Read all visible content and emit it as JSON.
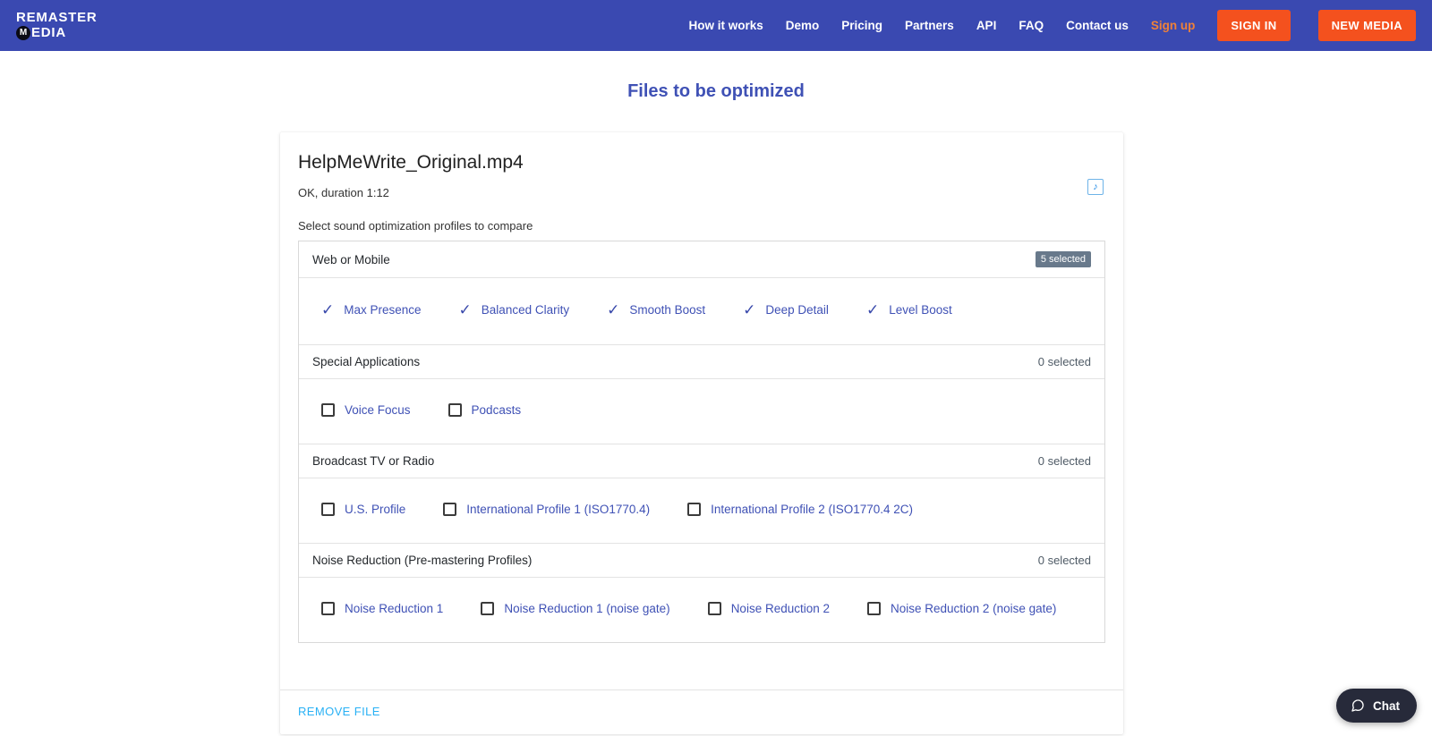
{
  "navbar": {
    "brand": {
      "line1": "REMASTER",
      "logo_letter": "M",
      "line2": "EDIA"
    },
    "links": [
      "How it works",
      "Demo",
      "Pricing",
      "Partners",
      "API",
      "FAQ",
      "Contact us"
    ],
    "signup_label": "Sign up",
    "signin_label": "SIGN IN",
    "new_media_label": "NEW MEDIA"
  },
  "page": {
    "title": "Files to be optimized"
  },
  "file_card": {
    "filename": "HelpMeWrite_Original.mp4",
    "status": "OK, duration 1:12",
    "audio_icon": "music-note-icon",
    "instruction": "Select sound optimization profiles to compare",
    "remove_label": "REMOVE FILE",
    "groups": [
      {
        "name": "Web or Mobile",
        "count": "5 selected",
        "profiles": [
          {
            "label": "Max Presence",
            "checked": true
          },
          {
            "label": "Balanced Clarity",
            "checked": true
          },
          {
            "label": "Smooth Boost",
            "checked": true
          },
          {
            "label": "Deep Detail",
            "checked": true
          },
          {
            "label": "Level Boost",
            "checked": true
          }
        ]
      },
      {
        "name": "Special Applications",
        "count": "0 selected",
        "profiles": [
          {
            "label": "Voice Focus",
            "checked": false
          },
          {
            "label": "Podcasts",
            "checked": false
          }
        ]
      },
      {
        "name": "Broadcast TV or Radio",
        "count": "0 selected",
        "profiles": [
          {
            "label": "U.S. Profile",
            "checked": false
          },
          {
            "label": "International Profile 1 (ISO1770.4)",
            "checked": false
          },
          {
            "label": "International Profile 2 (ISO1770.4 2C)",
            "checked": false
          }
        ]
      },
      {
        "name": "Noise Reduction (Pre-mastering Profiles)",
        "count": "0 selected",
        "profiles": [
          {
            "label": "Noise Reduction 1",
            "checked": false
          },
          {
            "label": "Noise Reduction 1 (noise gate)",
            "checked": false
          },
          {
            "label": "Noise Reduction 2",
            "checked": false
          },
          {
            "label": "Noise Reduction 2 (noise gate)",
            "checked": false
          }
        ]
      }
    ]
  },
  "chat": {
    "label": "Chat"
  },
  "colors": {
    "navbar_bg": "#3a49b1",
    "accent_orange": "#f4511e",
    "signup_orange": "#ef8138",
    "heading_blue": "#3f51b5",
    "profile_blue": "#3f51b5",
    "badge_gray": "#68798b",
    "remove_link_blue": "#29b1f5",
    "chat_bg": "#272a3a"
  }
}
